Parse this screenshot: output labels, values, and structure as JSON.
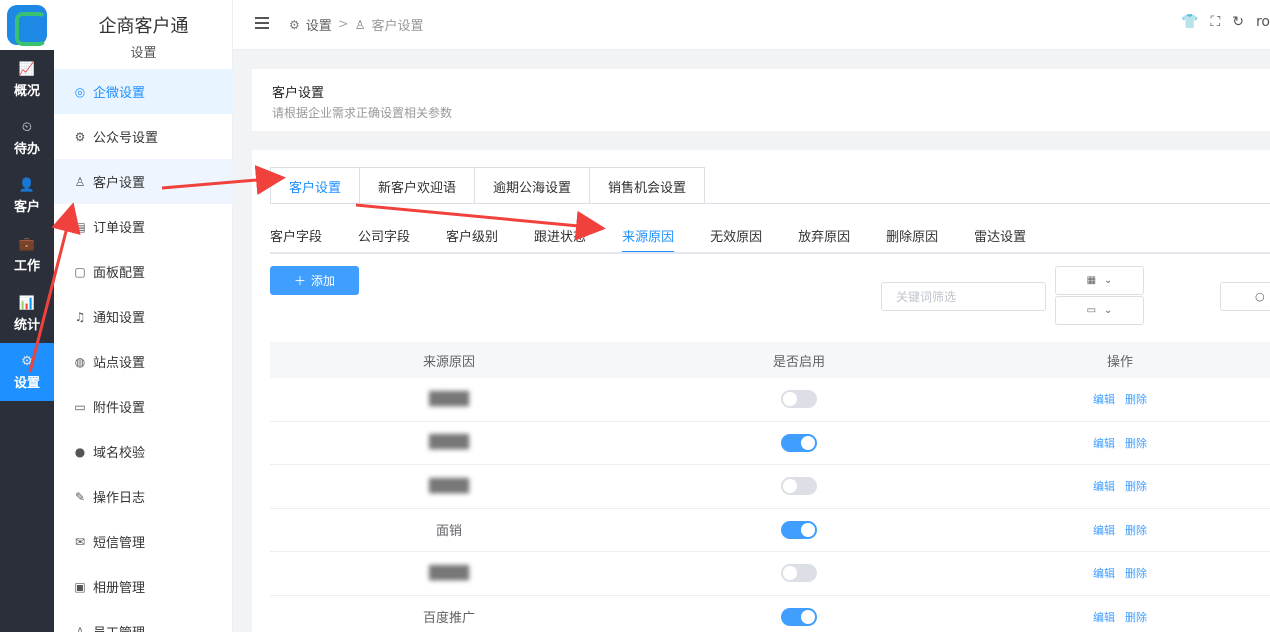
{
  "rail": {
    "items": [
      {
        "label": "概况",
        "icon": "trend-chart-icon",
        "glyph": "📈"
      },
      {
        "label": "待办",
        "icon": "clock-icon",
        "glyph": "⏲"
      },
      {
        "label": "客户",
        "icon": "user-icon",
        "glyph": "👤"
      },
      {
        "label": "工作",
        "icon": "briefcase-icon",
        "glyph": "💼"
      },
      {
        "label": "统计",
        "icon": "stats-icon",
        "glyph": "📊"
      },
      {
        "label": "设置",
        "icon": "gear-icon",
        "glyph": "⚙"
      }
    ],
    "active_index": 5
  },
  "submenu": {
    "title": "企商客户通",
    "subtitle": "设置",
    "items": [
      {
        "label": "企微设置",
        "icon": "wecom-icon",
        "glyph": "◎"
      },
      {
        "label": "公众号设置",
        "icon": "gear-icon",
        "glyph": "⚙"
      },
      {
        "label": "客户设置",
        "icon": "user-icon",
        "glyph": "♙"
      },
      {
        "label": "订单设置",
        "icon": "order-icon",
        "glyph": "▤"
      },
      {
        "label": "面板配置",
        "icon": "panel-icon",
        "glyph": "▢"
      },
      {
        "label": "通知设置",
        "icon": "bell-icon",
        "glyph": "♫"
      },
      {
        "label": "站点设置",
        "icon": "globe-icon",
        "glyph": "◍"
      },
      {
        "label": "附件设置",
        "icon": "folder-icon",
        "glyph": "▭"
      },
      {
        "label": "域名校验",
        "icon": "domain-icon",
        "glyph": "●"
      },
      {
        "label": "操作日志",
        "icon": "log-icon",
        "glyph": "✎"
      },
      {
        "label": "短信管理",
        "icon": "mail-icon",
        "glyph": "✉"
      },
      {
        "label": "相册管理",
        "icon": "album-icon",
        "glyph": "▣"
      },
      {
        "label": "员工管理",
        "icon": "staff-icon",
        "glyph": "♙"
      }
    ]
  },
  "topbar": {
    "breadcrumb_root": "设置",
    "breadcrumb_sep": ">",
    "breadcrumb_current": "客户设置",
    "user_fragment": "ro"
  },
  "header": {
    "title": "客户设置",
    "description": "请根据企业需求正确设置相关参数"
  },
  "top_tabs": [
    "客户设置",
    "新客户欢迎语",
    "逾期公海设置",
    "销售机会设置"
  ],
  "sub_tabs": [
    "客户字段",
    "公司字段",
    "客户级别",
    "跟进状态",
    "来源原因",
    "无效原因",
    "放弃原因",
    "删除原因",
    "雷达设置"
  ],
  "toolbar": {
    "add_label": "添加",
    "keyword_placeholder": "关键词筛选"
  },
  "table": {
    "headers": [
      "来源原因",
      "是否启用",
      "操作"
    ],
    "rows": [
      {
        "name": "",
        "enabled": false
      },
      {
        "name": "",
        "enabled": true
      },
      {
        "name": "",
        "enabled": false
      },
      {
        "name": "面销",
        "enabled": true
      },
      {
        "name": "",
        "enabled": false
      },
      {
        "name": "百度推广",
        "enabled": true
      }
    ],
    "edit_label": "编辑",
    "delete_label": "删除"
  },
  "colors": {
    "accent": "#1e90ff",
    "rail_bg": "#2b2f3a",
    "annotation_arrow": "#f0413c"
  }
}
